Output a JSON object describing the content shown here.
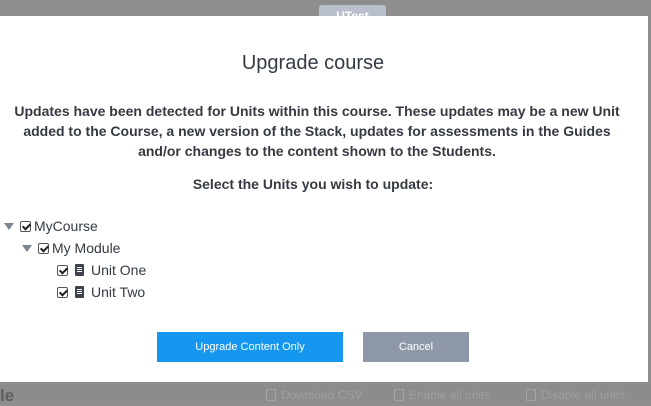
{
  "background": {
    "badge_text": "UTest",
    "bottom_title": "le",
    "actions": {
      "download_csv": "Download CSV",
      "enable_all": "Enable all units",
      "disable_all": "Disable all units"
    }
  },
  "modal": {
    "title": "Upgrade course",
    "description": "Updates have been detected for Units within this course. These updates may be a new Unit added to the Course, a new version of the Stack, updates for assessments in the Guides and/or changes to the content shown to the Students.",
    "prompt": "Select the Units you wish to update:",
    "tree": {
      "course": {
        "label": "MyCourse",
        "checked": true
      },
      "module": {
        "label": "My Module",
        "checked": true
      },
      "units": [
        {
          "label": "Unit One",
          "checked": true,
          "icon": "document-icon"
        },
        {
          "label": "Unit Two",
          "checked": true,
          "icon": "document-icon"
        }
      ]
    },
    "buttons": {
      "upgrade": "Upgrade Content Only",
      "cancel": "Cancel"
    }
  },
  "colors": {
    "primary": "#1597f0",
    "cancel": "#8f98a9",
    "overlay": "#8e8e8e"
  }
}
